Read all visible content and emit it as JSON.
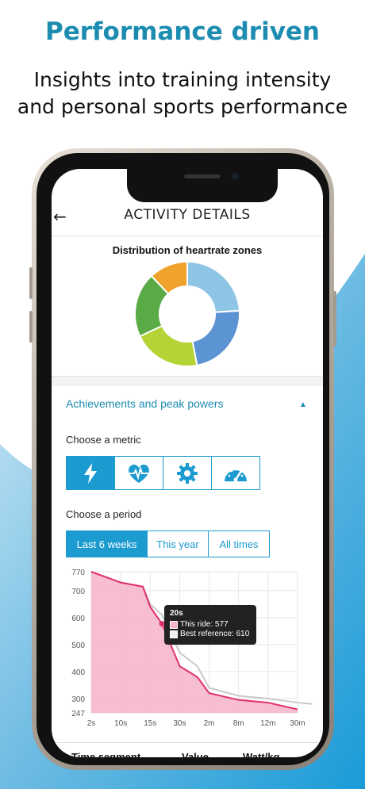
{
  "hero": {
    "headline": "Performance driven",
    "subline_1": "Insights into training intensity",
    "subline_2": "and personal sports performance"
  },
  "app": {
    "title": "ACTIVITY DETAILS",
    "back_icon": "arrow-left-icon"
  },
  "heartrate_card": {
    "title": "Distribution of heartrate zones"
  },
  "achievements": {
    "header": "Achievements and peak powers",
    "toggle_icon": "caret-up-icon",
    "choose_metric_label": "Choose a metric",
    "metrics": [
      {
        "icon": "lightning-icon",
        "active": true
      },
      {
        "icon": "heart-pulse-icon",
        "active": false
      },
      {
        "icon": "gear-icon",
        "active": false
      },
      {
        "icon": "speedometer-icon",
        "active": false
      }
    ],
    "choose_period_label": "Choose a period",
    "periods": [
      {
        "label": "Last 6 weeks",
        "active": true
      },
      {
        "label": "This year",
        "active": false
      },
      {
        "label": "All times",
        "active": false
      }
    ]
  },
  "tooltip": {
    "title": "20s",
    "this_ride": "This ride: 577",
    "best_reference": "Best reference: 610"
  },
  "table": {
    "col_time": "Time segment",
    "col_value": "Value",
    "col_unit": "Watt/kg"
  },
  "colors": {
    "accent": "#1c9bd0",
    "headline": "#1c8cb0",
    "this_ride_fill": "#f4b3c6",
    "this_ride_line": "#e0306a",
    "best_reference_line": "#c9c9c9"
  },
  "chart_data": [
    {
      "type": "pie",
      "title": "Distribution of heartrate zones",
      "donut": true,
      "slices": [
        {
          "value": 24,
          "color": "#8ec5e4"
        },
        {
          "value": 23,
          "color": "#5b93d3"
        },
        {
          "value": 21,
          "color": "#b4d335"
        },
        {
          "value": 20,
          "color": "#5aab45"
        },
        {
          "value": 12,
          "color": "#f0a32c"
        }
      ]
    },
    {
      "type": "area",
      "categories": [
        "2s",
        "10s",
        "15s",
        "30s",
        "2m",
        "8m",
        "12m",
        "30m"
      ],
      "y_ticks": [
        247,
        300,
        400,
        500,
        600,
        700,
        770
      ],
      "ylim": [
        247,
        770
      ],
      "grid": true,
      "series": [
        {
          "name": "This ride",
          "x": [
            0,
            1,
            1.75,
            2,
            2.4,
            3,
            3.6,
            4,
            5,
            6,
            7
          ],
          "values": [
            770,
            730,
            715,
            640,
            577,
            420,
            380,
            320,
            295,
            285,
            260
          ]
        },
        {
          "name": "Best reference",
          "x": [
            0,
            1,
            1.75,
            2,
            2.4,
            3,
            3.6,
            4,
            5,
            6,
            7,
            7.5
          ],
          "values": [
            770,
            730,
            715,
            650,
            610,
            470,
            420,
            340,
            310,
            300,
            285,
            280
          ]
        }
      ],
      "tooltip_point": {
        "x": "20s",
        "this_ride": 577,
        "best_reference": 610
      }
    }
  ]
}
